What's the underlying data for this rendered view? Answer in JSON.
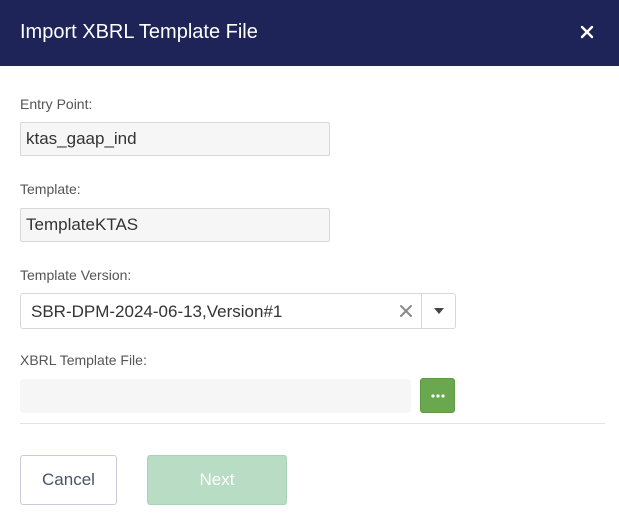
{
  "dialog": {
    "title": "Import XBRL Template File",
    "close_icon": "close-icon"
  },
  "form": {
    "entry_point": {
      "label": "Entry Point:",
      "value": "ktas_gaap_ind"
    },
    "template": {
      "label": "Template:",
      "value": "TemplateKTAS"
    },
    "template_version": {
      "label": "Template Version:",
      "selected": "SBR-DPM-2024-06-13,Version#1",
      "clear_icon": "clear-icon",
      "toggle_icon": "caret-down-icon"
    },
    "xbrl_file": {
      "label": "XBRL Template File:",
      "value": "",
      "browse_icon": "ellipsis-icon"
    }
  },
  "footer": {
    "cancel_label": "Cancel",
    "next_label": "Next"
  },
  "colors": {
    "header_bg": "#1e2457",
    "browse_bg": "#6aa84f",
    "next_disabled_bg": "#b8dcc4"
  }
}
